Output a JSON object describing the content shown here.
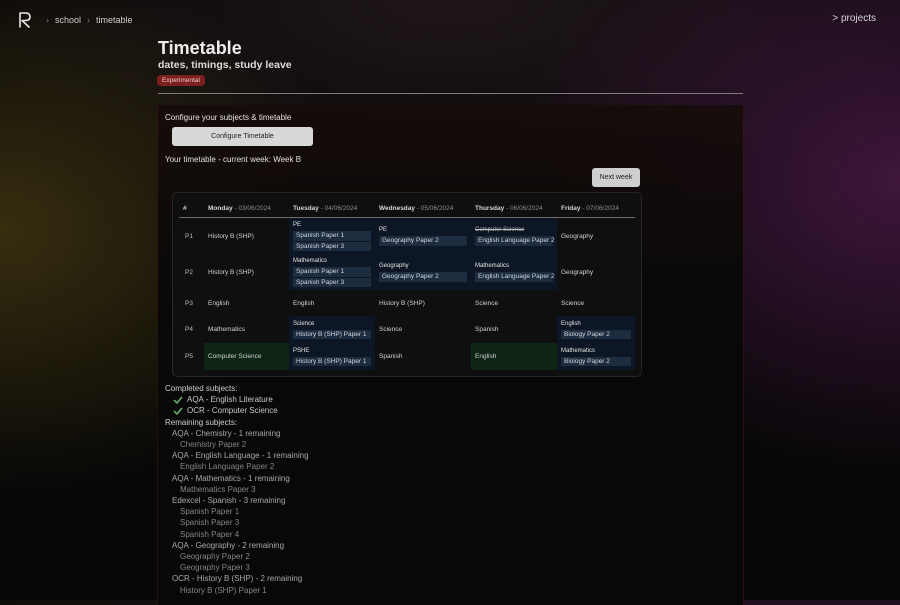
{
  "nav": {
    "breadcrumb": [
      "school",
      "timetable"
    ],
    "projects_link": "> projects"
  },
  "header": {
    "title": "Timetable",
    "subtitle": "dates, timings, study leave",
    "badge": "Experimental"
  },
  "config": {
    "label": "Configure your subjects & timetable",
    "button_label": "Configure Timetable",
    "current_week_text": "Your timetable - current week: Week B",
    "next_week_label": "Next week"
  },
  "timetable": {
    "corner": "#",
    "days": [
      {
        "name": "Monday",
        "date": " - 03/06/2024"
      },
      {
        "name": "Tuesday",
        "date": " - 04/06/2024"
      },
      {
        "name": "Wednesday",
        "date": " - 05/06/2024"
      },
      {
        "name": "Thursday",
        "date": " - 06/06/2024"
      },
      {
        "name": "Friday",
        "date": " - 07/06/2024"
      }
    ],
    "rows": [
      {
        "period": "P1",
        "cells": [
          {
            "text": "History B (SHP)"
          },
          {
            "title": "PE",
            "papers": [
              "Spanish Paper 1",
              "Spanish Paper 3"
            ],
            "tint": "blue"
          },
          {
            "title": "PE",
            "papers": [
              "Geography Paper 2"
            ],
            "tint": "blue"
          },
          {
            "title": "Computer Science",
            "strike": true,
            "papers": [
              "English Language Paper 2"
            ],
            "tint": "blue"
          },
          {
            "text": "Geography"
          }
        ]
      },
      {
        "period": "P2",
        "cells": [
          {
            "text": "History B (SHP)"
          },
          {
            "title": "Mathematics",
            "papers": [
              "Spanish Paper 1",
              "Spanish Paper 3"
            ],
            "tint": "blue"
          },
          {
            "title": "Geography",
            "papers": [
              "Geography Paper 2"
            ],
            "tint": "blue"
          },
          {
            "title": "Mathematics",
            "papers": [
              "English Language Paper 2"
            ],
            "tint": "blue"
          },
          {
            "text": "Geography"
          }
        ]
      },
      {
        "period": "P3",
        "cells": [
          {
            "text": "English"
          },
          {
            "text": "English"
          },
          {
            "text": "History B (SHP)"
          },
          {
            "text": "Science"
          },
          {
            "text": "Science"
          }
        ]
      },
      {
        "period": "P4",
        "cells": [
          {
            "text": "Mathematics"
          },
          {
            "title": "Science",
            "papers": [
              "History B (SHP) Paper 1"
            ],
            "tint": "blue"
          },
          {
            "text": "Science"
          },
          {
            "text": "Spanish"
          },
          {
            "title": "English",
            "papers": [
              "Biology Paper 2"
            ],
            "tint": "blue"
          }
        ]
      },
      {
        "period": "P5",
        "cells": [
          {
            "text": "Computer Science",
            "tint": "green"
          },
          {
            "title": "PSHE",
            "papers": [
              "History B (SHP) Paper 1"
            ],
            "tint": "blue"
          },
          {
            "text": "Spanish"
          },
          {
            "text": "English",
            "tint": "green"
          },
          {
            "title": "Mathematics",
            "papers": [
              "Biology Paper 2"
            ],
            "tint": "blue"
          }
        ]
      }
    ]
  },
  "completed": {
    "heading": "Completed subjects:",
    "items": [
      "AQA - English Literature",
      "OCR - Computer Science"
    ]
  },
  "remaining": {
    "heading": "Remaining subjects:",
    "subjects": [
      {
        "label": "AQA - Chemistry - 1 remaining",
        "papers": [
          "Chemistry Paper 2"
        ]
      },
      {
        "label": "AQA - English Language - 1 remaining",
        "papers": [
          "English Language Paper 2"
        ]
      },
      {
        "label": "AQA - Mathematics - 1 remaining",
        "papers": [
          "Mathematics Paper 3"
        ]
      },
      {
        "label": "Edexcel - Spanish - 3 remaining",
        "papers": [
          "Spanish Paper 1",
          "Spanish Paper 3",
          "Spanish Paper 4"
        ]
      },
      {
        "label": "AQA - Geography - 2 remaining",
        "papers": [
          "Geography Paper 2",
          "Geography Paper 3"
        ]
      },
      {
        "label": "OCR - History B (SHP) - 2 remaining",
        "papers": [
          "History B (SHP) Paper 1"
        ]
      }
    ]
  },
  "colors": {
    "badge_bg": "#7c1f1f",
    "cell_blue": "#0c1624",
    "cell_green": "#0e2414",
    "chip_bg": "#1e2c3f",
    "check": "#6fbf73"
  },
  "icons": {
    "logo": "r-logo-icon",
    "separator": "chevron-right-icon",
    "completed": "check-icon"
  }
}
